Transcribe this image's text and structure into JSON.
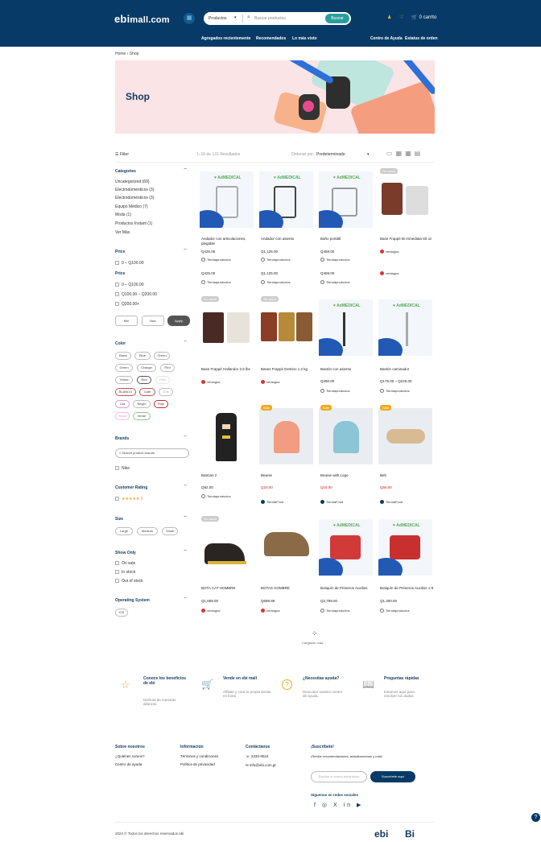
{
  "header": {
    "logo_prefix": "ebi",
    "logo_suffix": "mall.com",
    "search_category": "Productos",
    "search_placeholder": "Buscar productos",
    "search_button": "Buscar",
    "cart_label": "0 carrito",
    "nav_left": [
      "Agregados recientemente",
      "Recomendados",
      "Lo más visto"
    ],
    "nav_right": [
      "Centro de Ayuda",
      "Estatus de orden"
    ]
  },
  "breadcrumb": "Home › Shop",
  "banner_title": "Shop",
  "toolbar": {
    "filter_label": "Filter",
    "results": "1–16 de 131 Resultados",
    "sort_label": "Ordenar por:",
    "sort_value": "Predeterminado"
  },
  "filters": {
    "categories_title": "Categories",
    "categories": [
      "Uncategorized (69)",
      "Electrodomésticos (3)",
      "Equipo Médico (7)",
      "Moda (1)",
      "Productos Instant (1)"
    ],
    "ver_mas": "Ver Más",
    "price_title": "Price",
    "price_items": [
      "0 – Q100.00",
      "Q100.00 – Q200.00",
      "Q200.00+"
    ],
    "price_min": "Min",
    "price_max": "Max",
    "apply": "Apply",
    "color_title": "Color",
    "colors": [
      "Black",
      "Blue",
      "Green",
      "Orange",
      "Red",
      "Yellow",
      "Pink",
      "BLANCO",
      "Café",
      "Gris",
      "Lila",
      "Negro",
      "Rojo",
      "Rosa",
      "Verde"
    ],
    "brands_title": "Brands",
    "brands_search": "Search product brands",
    "brands_item": "Nike",
    "rating_title": "Customer Rating",
    "rating_item": "★★★★★ 5",
    "size_title": "Size",
    "sizes": [
      "Large",
      "Medium",
      "Small"
    ],
    "show_title": "Show Only",
    "show_items": [
      "On sale",
      "In stock",
      "Out of stock"
    ],
    "os_title": "Operating System",
    "os_item": "iOS"
  },
  "products": [
    {
      "name": "Andador con articulaciones, plegable",
      "price": "Q425.00",
      "seller": "Tiendaproductos"
    },
    {
      "name": "Andador con asiento",
      "price": "Q1,125.00",
      "seller": "Tiendaproductos"
    },
    {
      "name": "Baño portátil",
      "price": "Q459.00",
      "seller": "Tiendaproductos"
    },
    {
      "name": "Base Frappé Bi Inmediata 50 oz",
      "price": "",
      "seller": "ventagua"
    },
    {
      "name": "Base Frappé Hallandor 2.5 lbs",
      "price": "",
      "seller": "ventagua"
    },
    {
      "name": "Bases Frappé Destino 1.2 kg",
      "price": "",
      "seller": "ventagua"
    },
    {
      "name": "Bastón con asiento",
      "price": "Q290.00",
      "seller": "Tiendaproductos"
    },
    {
      "name": "Bastón caminador",
      "price": "Q175.00 – Q225.00",
      "seller": "Tiendaproductos"
    },
    {
      "name": "Batman 2",
      "price": "Q82.00",
      "seller": "Tiendaproductos"
    },
    {
      "name": "Beanie",
      "price": "Q20.00",
      "seller": "TiendaFood"
    },
    {
      "name": "Beanie with Logo",
      "price": "Q18.00",
      "seller": "TiendaFood"
    },
    {
      "name": "Belt",
      "price": "Q55.00",
      "seller": "TiendaFood"
    },
    {
      "name": "BOTA CAT HOMBRE",
      "price": "Q1,659.00",
      "seller": "ventagua"
    },
    {
      "name": "BOTAS HOMBRE",
      "price": "Q699.99",
      "seller": "ventagua"
    },
    {
      "name": "Botiquín de Primeros Auxilios",
      "price": "Q2,799.00",
      "seller": "Tiendaproductos"
    },
    {
      "name": "Botiquín de Primeros Auxilios 1-5",
      "price": "Q1,300.00",
      "seller": "Tiendaproductos"
    }
  ],
  "load_more": "Cargando más...",
  "features": [
    {
      "title": "Conoce los beneficios de ebi",
      "text": "Disfruta de nuestras alianzas"
    },
    {
      "title": "Vende en ebi mall",
      "text": "Afíliate y crea tu propia tienda en línea"
    },
    {
      "title": "¿Necesitas ayuda?",
      "text": "Descubre nuestro centro de ayuda."
    },
    {
      "title": "Preguntas rápidas",
      "text": "Estamos aquí para resolver tus dudas"
    }
  ],
  "footer": {
    "col1_title": "Sobre nosotros",
    "col1": [
      "¿Quiénes somos?",
      "Centro de ayuda"
    ],
    "col2_title": "Información",
    "col2": [
      "Términos y condiciones",
      "Política de privacidad"
    ],
    "col3_title": "Contáctanos",
    "col3": [
      "2433-9024",
      "info@ebi.com.gt"
    ],
    "sub_title": "¡Suscríbete!",
    "sub_text": "¡Recibe recomendaciones, actualizaciones y más!",
    "sub_placeholder": "Escribe tu correo electrónico",
    "sub_button": "Suscríbete aquí",
    "social_title": "Síguenos en redes sociales",
    "copyright": "2024 © Todos los derechos reservados ebi",
    "brand1": "ebi",
    "brand2": "Bi"
  }
}
